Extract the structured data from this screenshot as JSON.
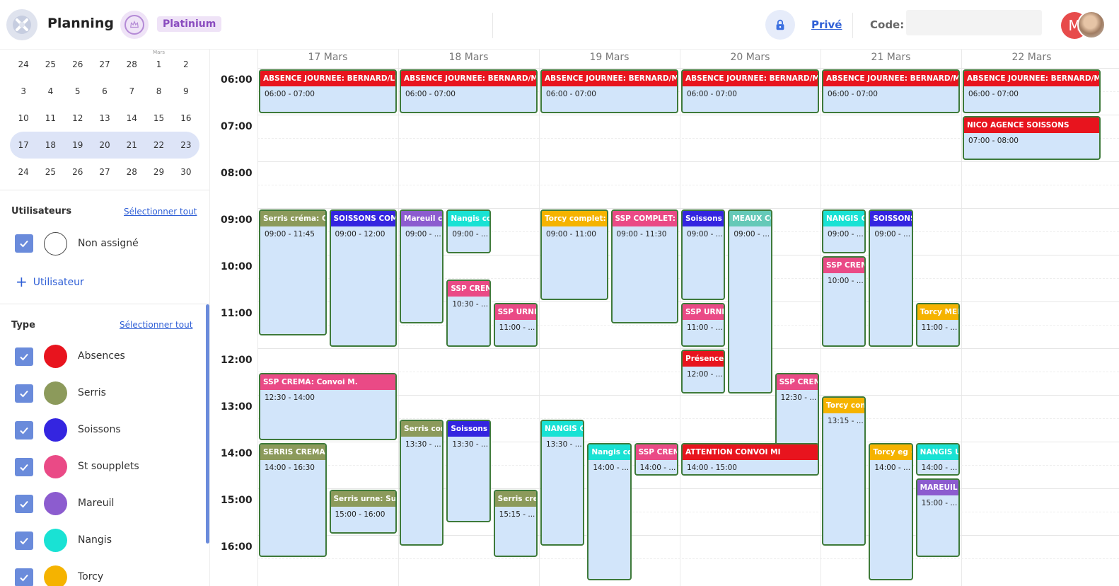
{
  "header": {
    "title": "Planning",
    "badge": "Platinium",
    "privacy_link": "Privé",
    "code_label": "Code:",
    "code_value": "",
    "avatar_initial": "M",
    "icons": [
      "app-logo-icon",
      "crown-icon",
      "lock-icon"
    ]
  },
  "mini_calendar": {
    "month_label": "Mars",
    "weeks": [
      [
        "24",
        "25",
        "26",
        "27",
        "28",
        "1",
        "2"
      ],
      [
        "3",
        "4",
        "5",
        "6",
        "7",
        "8",
        "9"
      ],
      [
        "10",
        "11",
        "12",
        "13",
        "14",
        "15",
        "16"
      ],
      [
        "17",
        "18",
        "19",
        "20",
        "21",
        "22",
        "23"
      ],
      [
        "24",
        "25",
        "26",
        "27",
        "28",
        "29",
        "30"
      ]
    ],
    "selected_week_index": 3
  },
  "users_section": {
    "title": "Utilisateurs",
    "select_all": "Sélectionner tout",
    "items": [
      {
        "label": "Non assigné",
        "checked": true
      }
    ],
    "add_label": "Utilisateur"
  },
  "type_section": {
    "title": "Type",
    "select_all": "Sélectionner tout",
    "items": [
      {
        "label": "Absences",
        "color": "#e8141e",
        "checked": true
      },
      {
        "label": "Serris",
        "color": "#8c9a5b",
        "checked": true
      },
      {
        "label": "Soissons",
        "color": "#3425e0",
        "checked": true
      },
      {
        "label": "St soupplets",
        "color": "#ea4a86",
        "checked": true
      },
      {
        "label": "Mareuil",
        "color": "#8c5ccf",
        "checked": true
      },
      {
        "label": "Nangis",
        "color": "#19e2d4",
        "checked": true
      },
      {
        "label": "Torcy",
        "color": "#f5b300",
        "checked": true
      }
    ]
  },
  "calendar": {
    "days": [
      "17 Mars",
      "18 Mars",
      "19 Mars",
      "20 Mars",
      "21 Mars",
      "22 Mars"
    ],
    "hours": [
      "06:00",
      "07:00",
      "08:00",
      "09:00",
      "10:00",
      "11:00",
      "12:00",
      "13:00",
      "14:00",
      "15:00",
      "16:00"
    ],
    "events": [
      {
        "day": 0,
        "lane": 0,
        "lanes": 1,
        "start": 6,
        "end": 7,
        "title": "ABSENCE JOURNEE: BERNARD/LUC",
        "time": "06:00 - 07:00",
        "color": "#e8141e"
      },
      {
        "day": 1,
        "lane": 0,
        "lanes": 1,
        "start": 6,
        "end": 7,
        "title": "ABSENCE JOURNEE: BERNARD/MAT",
        "time": "06:00 - 07:00",
        "color": "#e8141e"
      },
      {
        "day": 2,
        "lane": 0,
        "lanes": 1,
        "start": 6,
        "end": 7,
        "title": "ABSENCE JOURNEE: BERNARD/MAT",
        "time": "06:00 - 07:00",
        "color": "#e8141e"
      },
      {
        "day": 3,
        "lane": 0,
        "lanes": 1,
        "start": 6,
        "end": 7,
        "title": "ABSENCE JOURNEE: BERNARD/MAT",
        "time": "06:00 - 07:00",
        "color": "#e8141e"
      },
      {
        "day": 4,
        "lane": 0,
        "lanes": 1,
        "start": 6,
        "end": 7,
        "title": "ABSENCE JOURNEE: BERNARD/MAT",
        "time": "06:00 - 07:00",
        "color": "#e8141e"
      },
      {
        "day": 5,
        "lane": 0,
        "lanes": 1,
        "start": 6,
        "end": 7,
        "title": "ABSENCE JOURNEE: BERNARD/MAT",
        "time": "06:00 - 07:00",
        "color": "#e8141e"
      },
      {
        "day": 5,
        "lane": 0,
        "lanes": 1,
        "start": 7,
        "end": 8,
        "title": "NICO AGENCE SOISSONS",
        "time": "07:00 - 08:00",
        "color": "#e8141e"
      },
      {
        "day": 0,
        "lane": 0,
        "lanes": 2,
        "start": 9,
        "end": 11.75,
        "title": "Serris créma: Con",
        "time": "09:00 - 11:45",
        "color": "#8c9a5b"
      },
      {
        "day": 0,
        "lane": 1,
        "lanes": 2,
        "start": 9,
        "end": 12,
        "title": "SOISSONS COMP",
        "time": "09:00 - 12:00",
        "color": "#3425e0"
      },
      {
        "day": 0,
        "lane": 0,
        "lanes": 1,
        "start": 12.5,
        "end": 14,
        "title": "SSP CREMA: Convoi M.",
        "time": "12:30 - 14:00",
        "color": "#ea4a86"
      },
      {
        "day": 0,
        "lane": 0,
        "lanes": 2,
        "start": 14,
        "end": 16.5,
        "title": "SERRIS CREMA: C",
        "time": "14:00 - 16:30",
        "color": "#8c9a5b"
      },
      {
        "day": 0,
        "lane": 1,
        "lanes": 2,
        "start": 15,
        "end": 16,
        "title": "Serris urne: Suite",
        "time": "15:00 - 16:00",
        "color": "#8c9a5b"
      },
      {
        "day": 1,
        "lane": 0,
        "lanes": 3,
        "start": 9,
        "end": 11.5,
        "title": "Mareuil co",
        "time": "09:00 - ...",
        "color": "#8c5ccf"
      },
      {
        "day": 1,
        "lane": 1,
        "lanes": 3,
        "start": 9,
        "end": 10,
        "title": "Nangis con",
        "time": "09:00 - ...",
        "color": "#19e2d4"
      },
      {
        "day": 1,
        "lane": 1,
        "lanes": 3,
        "start": 10.5,
        "end": 12,
        "title": "SSP CREMA",
        "time": "10:30 - ...",
        "color": "#ea4a86"
      },
      {
        "day": 1,
        "lane": 2,
        "lanes": 3,
        "start": 11,
        "end": 12,
        "title": "SSP URNE:",
        "time": "11:00 - ...",
        "color": "#ea4a86"
      },
      {
        "day": 1,
        "lane": 0,
        "lanes": 3,
        "start": 13.5,
        "end": 16.25,
        "title": "Serris comp",
        "time": "13:30 - ...",
        "color": "#8c9a5b"
      },
      {
        "day": 1,
        "lane": 1,
        "lanes": 3,
        "start": 13.5,
        "end": 15.75,
        "title": "Soissons co",
        "time": "13:30 - ...",
        "color": "#3425e0"
      },
      {
        "day": 1,
        "lane": 2,
        "lanes": 3,
        "start": 15,
        "end": 16.5,
        "title": "Serris crem",
        "time": "15:15 - ...",
        "color": "#8c9a5b"
      },
      {
        "day": 2,
        "lane": 0,
        "lanes": 2,
        "start": 9,
        "end": 11,
        "title": "Torcy complet: C",
        "time": "09:00 - 11:00",
        "color": "#f5b300"
      },
      {
        "day": 2,
        "lane": 1,
        "lanes": 2,
        "start": 9,
        "end": 11.5,
        "title": "SSP COMPLET: C",
        "time": "09:00 - 11:30",
        "color": "#ea4a86"
      },
      {
        "day": 2,
        "lane": 0,
        "lanes": 3,
        "start": 13.5,
        "end": 16.25,
        "title": "NANGIS CO",
        "time": "13:30 - ...",
        "color": "#19e2d4"
      },
      {
        "day": 2,
        "lane": 1,
        "lanes": 3,
        "start": 14,
        "end": 17,
        "title": "Nangis con",
        "time": "14:00 - ...",
        "color": "#19e2d4"
      },
      {
        "day": 2,
        "lane": 2,
        "lanes": 3,
        "start": 14,
        "end": 14.75,
        "title": "SSP CREMA",
        "time": "14:00 - ...",
        "color": "#ea4a86"
      },
      {
        "day": 3,
        "lane": 0,
        "lanes": 3,
        "start": 9,
        "end": 11,
        "title": "Soissons co",
        "time": "09:00 - ...",
        "color": "#3425e0"
      },
      {
        "day": 3,
        "lane": 1,
        "lanes": 3,
        "start": 9,
        "end": 13,
        "title": "MEAUX CO",
        "time": "09:00 - ...",
        "color": "#65c9b8"
      },
      {
        "day": 3,
        "lane": 0,
        "lanes": 3,
        "start": 11,
        "end": 12,
        "title": "SSP URNE:",
        "time": "11:00 - ...",
        "color": "#ea4a86"
      },
      {
        "day": 3,
        "lane": 0,
        "lanes": 3,
        "start": 12,
        "end": 13,
        "title": "Présence S",
        "time": "12:00 - ...",
        "color": "#e8141e"
      },
      {
        "day": 3,
        "lane": 2,
        "lanes": 3,
        "start": 12.5,
        "end": 14.25,
        "title": "SSP CREMA",
        "time": "12:30 - ...",
        "color": "#ea4a86"
      },
      {
        "day": 3,
        "lane": 0,
        "lanes": 1,
        "start": 14,
        "end": 14.75,
        "title": "ATTENTION CONVOI MI",
        "time": "14:00 - 15:00",
        "color": "#e8141e"
      },
      {
        "day": 4,
        "lane": 0,
        "lanes": 3,
        "start": 9,
        "end": 10,
        "title": "NANGIS CE",
        "time": "09:00 - ...",
        "color": "#19e2d4"
      },
      {
        "day": 4,
        "lane": 1,
        "lanes": 3,
        "start": 9,
        "end": 12,
        "title": "SOISSONS",
        "time": "09:00 - ...",
        "color": "#3425e0"
      },
      {
        "day": 4,
        "lane": 0,
        "lanes": 3,
        "start": 10,
        "end": 12,
        "title": "SSP CREMA",
        "time": "10:00 - ...",
        "color": "#ea4a86"
      },
      {
        "day": 4,
        "lane": 2,
        "lanes": 3,
        "start": 11,
        "end": 12,
        "title": "Torcy MEB",
        "time": "11:00 - ...",
        "color": "#f5b300"
      },
      {
        "day": 4,
        "lane": 0,
        "lanes": 3,
        "start": 13,
        "end": 16.25,
        "title": "Torcy comp",
        "time": "13:15 - ...",
        "color": "#f5b300"
      },
      {
        "day": 4,
        "lane": 1,
        "lanes": 3,
        "start": 14,
        "end": 17,
        "title": "Torcy eg +",
        "time": "14:00 - ...",
        "color": "#f5b300"
      },
      {
        "day": 4,
        "lane": 2,
        "lanes": 3,
        "start": 14,
        "end": 14.75,
        "title": "NANGIS UF",
        "time": "14:00 - ...",
        "color": "#19e2d4"
      },
      {
        "day": 4,
        "lane": 2,
        "lanes": 3,
        "start": 14.75,
        "end": 16.5,
        "title": "MAREUIL C",
        "time": "15:00 - ...",
        "color": "#8c5ccf"
      }
    ]
  }
}
